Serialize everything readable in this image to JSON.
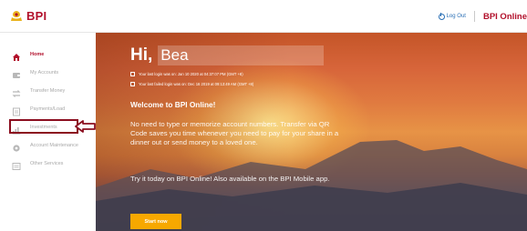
{
  "header": {
    "logo_text": "BPI",
    "logout_label": "Log Out",
    "brand_label": "BPI Online"
  },
  "sidebar": {
    "items": [
      {
        "label": "Home",
        "icon": "home-icon",
        "active": true
      },
      {
        "label": "My Accounts",
        "icon": "wallet-icon",
        "active": false
      },
      {
        "label": "Transfer Money",
        "icon": "transfer-icon",
        "active": false
      },
      {
        "label": "Payments/Load",
        "icon": "payments-icon",
        "active": false
      },
      {
        "label": "Investments",
        "icon": "chart-icon",
        "active": false
      },
      {
        "label": "Account Maintenance",
        "icon": "settings-icon",
        "active": false
      },
      {
        "label": "Other Services",
        "icon": "list-icon",
        "active": false
      }
    ]
  },
  "hero": {
    "greeting": "Hi,",
    "user_name": "Bea",
    "last_login": "Your last login was on: Jan 10 2020 at 04:37:07 PM (GMT +8)",
    "last_failed_login": "Your last failed login was on: Dec 16 2019 at 09:13:49 AM (GMT +8)",
    "welcome_title": "Welcome to BPI Online!",
    "paragraph_1": "No need to type or memorize account numbers. Transfer via QR Code saves you time whenever you need to pay for your share in a dinner out or send money to a loved one.",
    "paragraph_2": "Try it today on BPI Online! Also available on the BPI Mobile app.",
    "cta_label": "Start now"
  },
  "colors": {
    "brand_red": "#b2102b",
    "cta_yellow": "#f7a800",
    "link_blue": "#2a6fb5"
  }
}
